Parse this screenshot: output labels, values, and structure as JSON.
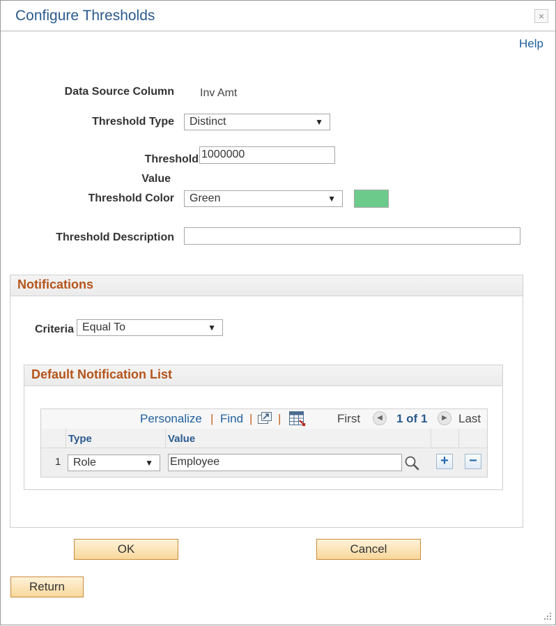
{
  "dialog": {
    "title": "Configure Thresholds",
    "close_glyph": "×",
    "help_label": "Help"
  },
  "form": {
    "data_source_column_label": "Data Source Column",
    "data_source_column_value": "Inv Amt",
    "threshold_type_label": "Threshold Type",
    "threshold_type_value": "Distinct",
    "threshold_value_label_1": "Threshold",
    "threshold_value_label_2": "Value",
    "threshold_value": "1000000",
    "threshold_color_label": "Threshold Color",
    "threshold_color_value": "Green",
    "threshold_color_swatch": "#6ccb8a",
    "threshold_description_label": "Threshold Description",
    "threshold_description_value": ""
  },
  "notifications": {
    "title": "Notifications",
    "criteria_label": "Criteria",
    "criteria_value": "Equal To",
    "list": {
      "title": "Default Notification List",
      "toolbar": {
        "personalize": "Personalize",
        "find": "Find",
        "first": "First",
        "range": "1 of 1",
        "last": "Last"
      },
      "columns": [
        "Type",
        "Value"
      ],
      "rows": [
        {
          "num": "1",
          "type": "Role",
          "value": "Employee"
        }
      ]
    }
  },
  "buttons": {
    "ok": "OK",
    "cancel": "Cancel",
    "return": "Return"
  },
  "icons": [
    "close-icon",
    "dropdown-arrow-icon",
    "zoom-icon",
    "download-grid-icon",
    "prev-icon",
    "next-icon",
    "search-icon",
    "add-row-icon",
    "delete-row-icon",
    "resize-grip-icon"
  ]
}
